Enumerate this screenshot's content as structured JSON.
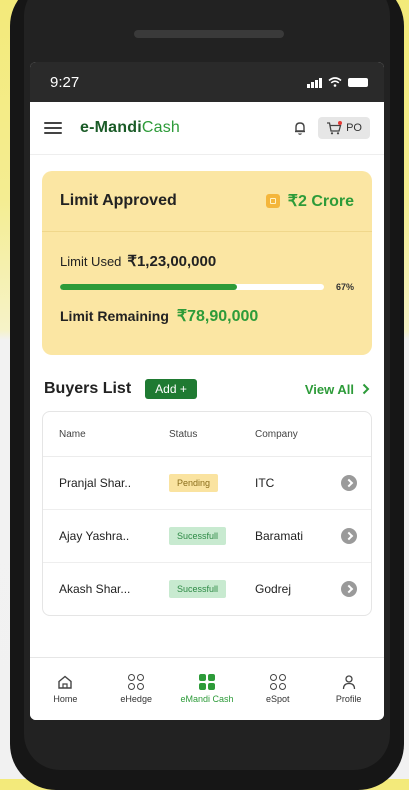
{
  "status_bar": {
    "time": "9:27"
  },
  "header": {
    "logo_prefix": "e-",
    "logo_main": "Mandi",
    "logo_suffix": "Cash",
    "cart_label": "PO"
  },
  "limit_card": {
    "title": "Limit Approved",
    "approved_value": "₹2 Crore",
    "used_label": "Limit Used",
    "used_value": "₹1,23,00,000",
    "progress_percent": 67,
    "progress_label": "67%",
    "remaining_label": "Limit Remaining",
    "remaining_value": "₹78,90,000"
  },
  "buyers": {
    "title": "Buyers List",
    "add_label": "Add +",
    "view_all_label": "View All",
    "columns": [
      "Name",
      "Status",
      "Company"
    ],
    "rows": [
      {
        "name": "Pranjal Shar..",
        "status": "Pending",
        "company": "ITC"
      },
      {
        "name": "Ajay Yashra..",
        "status": "Sucessfull",
        "company": "Baramati"
      },
      {
        "name": "Akash Shar...",
        "status": "Sucessfull",
        "company": "Godrej"
      }
    ]
  },
  "bottom_nav": {
    "items": [
      {
        "label": "Home",
        "icon": "home-icon"
      },
      {
        "label": "eHedge",
        "icon": "grid-icon"
      },
      {
        "label": "eMandi Cash",
        "icon": "grid-filled-icon"
      },
      {
        "label": "eSpot",
        "icon": "grid-icon"
      },
      {
        "label": "Profile",
        "icon": "profile-icon"
      }
    ],
    "active_index": 2
  },
  "colors": {
    "brand_green": "#2d9b39",
    "card_bg": "#fbe6a3",
    "pending_bg": "#fae3a0",
    "success_bg": "#c8ead0"
  }
}
